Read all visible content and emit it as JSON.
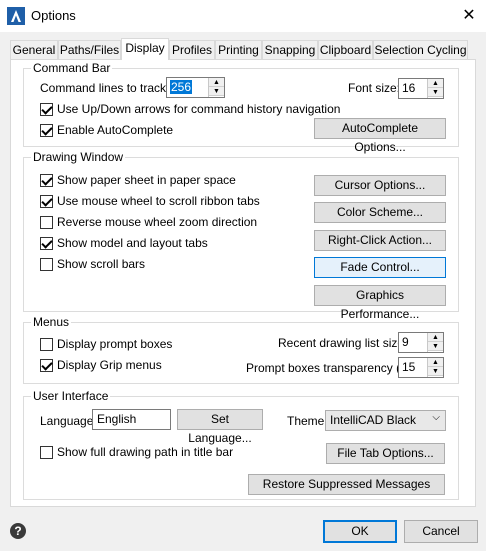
{
  "window": {
    "title": "Options",
    "close": "✕",
    "help": "?"
  },
  "tabs": [
    "General",
    "Paths/Files",
    "Display",
    "Profiles",
    "Printing",
    "Snapping",
    "Clipboard",
    "Selection Cycling"
  ],
  "active_tab": "Display",
  "command_bar": {
    "title": "Command Bar",
    "lines_label": "Command lines to track:",
    "lines_value": "256",
    "font_size_label": "Font size:",
    "font_size_value": "16",
    "updown_label": "Use Up/Down arrows for command history navigation",
    "updown_checked": true,
    "autocomplete_label": "Enable AutoComplete",
    "autocomplete_checked": true,
    "autocomplete_options": "AutoComplete Options..."
  },
  "drawing_window": {
    "title": "Drawing Window",
    "options": [
      {
        "label": "Show paper sheet in paper space",
        "checked": true
      },
      {
        "label": "Use mouse wheel to scroll ribbon tabs",
        "checked": true
      },
      {
        "label": "Reverse mouse wheel zoom direction",
        "checked": false
      },
      {
        "label": "Show model and layout tabs",
        "checked": true
      },
      {
        "label": "Show scroll bars",
        "checked": false
      }
    ],
    "buttons": [
      "Cursor Options...",
      "Color Scheme...",
      "Right-Click Action...",
      "Fade Control...",
      "Graphics Performance..."
    ]
  },
  "menus": {
    "title": "Menus",
    "prompt_boxes": {
      "label": "Display prompt boxes",
      "checked": false
    },
    "grip_menus": {
      "label": "Display Grip menus",
      "checked": true
    },
    "recent_label": "Recent drawing list size:",
    "recent_value": "9",
    "transparency_label": "Prompt boxes transparency (%):",
    "transparency_value": "15"
  },
  "user_interface": {
    "title": "User Interface",
    "language_label": "Language",
    "language_value": "English",
    "set_language": "Set Language...",
    "theme_label": "Theme",
    "theme_value": "IntelliCAD Black",
    "full_path": {
      "label": "Show full drawing path in title bar",
      "checked": false
    },
    "file_tab_options": "File Tab Options...",
    "restore_messages": "Restore Suppressed Messages"
  },
  "footer": {
    "ok": "OK",
    "cancel": "Cancel"
  }
}
